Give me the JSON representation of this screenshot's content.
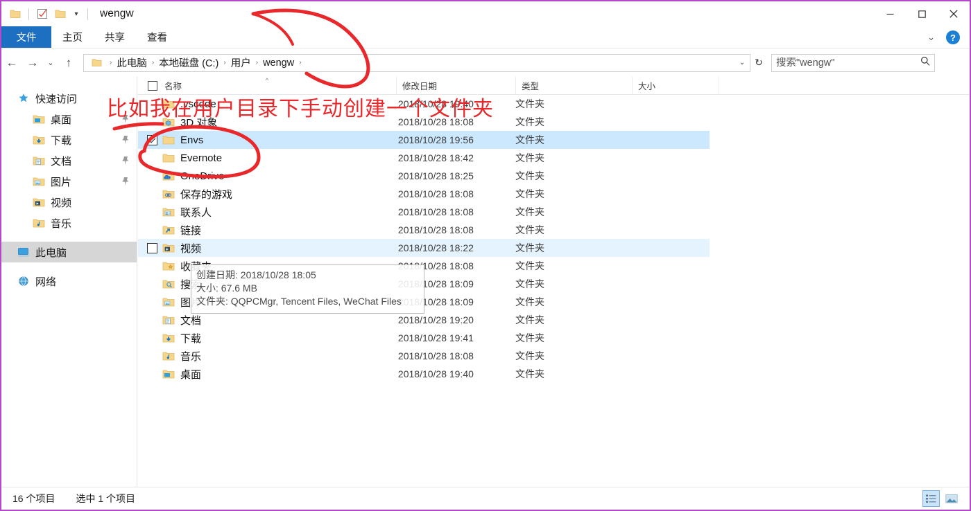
{
  "window": {
    "title": "wengw",
    "qat": [
      {
        "name": "folder-icon",
        "label": ""
      },
      {
        "name": "properties-icon",
        "label": ""
      },
      {
        "name": "new-folder-icon",
        "label": ""
      }
    ],
    "controls": {
      "minimize": "—",
      "maximize": "□",
      "close": "✕"
    }
  },
  "ribbon": {
    "tabs": [
      {
        "label": "文件",
        "active": true
      },
      {
        "label": "主页",
        "active": false
      },
      {
        "label": "共享",
        "active": false
      },
      {
        "label": "查看",
        "active": false
      }
    ],
    "collapse_chevron": "⌄",
    "help_label": "?"
  },
  "addressbar": {
    "back": "←",
    "forward": "→",
    "recent": "⌄",
    "up": "↑",
    "breadcrumbs": [
      "此电脑",
      "本地磁盘 (C:)",
      "用户",
      "wengw"
    ],
    "separator": "›",
    "dropdown": "⌄",
    "refresh": "↻",
    "search": {
      "placeholder": "搜索\"wengw\"",
      "value": "",
      "icon": "search-icon"
    }
  },
  "navpane": {
    "items": [
      {
        "label": "快速访问",
        "icon": "star-icon",
        "level": "root",
        "pinned": false,
        "selected": false
      },
      {
        "label": "桌面",
        "icon": "desktop-folder-icon",
        "level": "child",
        "pinned": true,
        "selected": false
      },
      {
        "label": "下载",
        "icon": "downloads-folder-icon",
        "level": "child",
        "pinned": true,
        "selected": false
      },
      {
        "label": "文档",
        "icon": "documents-folder-icon",
        "level": "child",
        "pinned": true,
        "selected": false
      },
      {
        "label": "图片",
        "icon": "pictures-folder-icon",
        "level": "child",
        "pinned": true,
        "selected": false
      },
      {
        "label": "视频",
        "icon": "videos-folder-icon",
        "level": "child",
        "pinned": false,
        "selected": false
      },
      {
        "label": "音乐",
        "icon": "music-folder-icon",
        "level": "child",
        "pinned": false,
        "selected": false
      },
      {
        "label": "此电脑",
        "icon": "this-pc-icon",
        "level": "root",
        "pinned": false,
        "selected": true
      },
      {
        "label": "网络",
        "icon": "network-icon",
        "level": "root",
        "pinned": false,
        "selected": false
      }
    ]
  },
  "filelist": {
    "columns": [
      {
        "key": "name",
        "label": "名称",
        "sorted": true
      },
      {
        "key": "date",
        "label": "修改日期",
        "sorted": false
      },
      {
        "key": "type",
        "label": "类型",
        "sorted": false
      },
      {
        "key": "size",
        "label": "大小",
        "sorted": false
      }
    ],
    "rows": [
      {
        "name": ".vscode",
        "date": "2018/10/28 19:40",
        "type": "文件夹",
        "size": "",
        "icon": "folder-icon",
        "state": "normal",
        "checkbox": "none"
      },
      {
        "name": "3D 对象",
        "date": "2018/10/28 18:08",
        "type": "文件夹",
        "size": "",
        "icon": "3d-objects-folder-icon",
        "state": "normal",
        "checkbox": "none"
      },
      {
        "name": "Envs",
        "date": "2018/10/28 19:56",
        "type": "文件夹",
        "size": "",
        "icon": "folder-icon",
        "state": "selected",
        "checkbox": "checked"
      },
      {
        "name": "Evernote",
        "date": "2018/10/28 18:42",
        "type": "文件夹",
        "size": "",
        "icon": "folder-icon",
        "state": "normal",
        "checkbox": "none"
      },
      {
        "name": "OneDrive",
        "date": "2018/10/28 18:25",
        "type": "文件夹",
        "size": "",
        "icon": "onedrive-folder-icon",
        "state": "normal",
        "checkbox": "none"
      },
      {
        "name": "保存的游戏",
        "date": "2018/10/28 18:08",
        "type": "文件夹",
        "size": "",
        "icon": "saved-games-folder-icon",
        "state": "normal",
        "checkbox": "none"
      },
      {
        "name": "联系人",
        "date": "2018/10/28 18:08",
        "type": "文件夹",
        "size": "",
        "icon": "contacts-folder-icon",
        "state": "normal",
        "checkbox": "none"
      },
      {
        "name": "链接",
        "date": "2018/10/28 18:08",
        "type": "文件夹",
        "size": "",
        "icon": "links-folder-icon",
        "state": "normal",
        "checkbox": "none"
      },
      {
        "name": "视频",
        "date": "2018/10/28 18:22",
        "type": "文件夹",
        "size": "",
        "icon": "videos-folder-icon",
        "state": "hover",
        "checkbox": "unchecked"
      },
      {
        "name": "收藏夹",
        "date": "2018/10/28 18:08",
        "type": "文件夹",
        "size": "",
        "icon": "favorites-folder-icon",
        "state": "normal",
        "checkbox": "none"
      },
      {
        "name": "搜索",
        "date": "2018/10/28 18:09",
        "type": "文件夹",
        "size": "",
        "icon": "searches-folder-icon",
        "state": "normal",
        "checkbox": "none"
      },
      {
        "name": "图片",
        "date": "2018/10/28 18:09",
        "type": "文件夹",
        "size": "",
        "icon": "pictures-folder-icon",
        "state": "normal",
        "checkbox": "none"
      },
      {
        "name": "文档",
        "date": "2018/10/28 19:20",
        "type": "文件夹",
        "size": "",
        "icon": "documents-folder-icon",
        "state": "normal",
        "checkbox": "none"
      },
      {
        "name": "下载",
        "date": "2018/10/28 19:41",
        "type": "文件夹",
        "size": "",
        "icon": "downloads-folder-icon",
        "state": "normal",
        "checkbox": "none"
      },
      {
        "name": "音乐",
        "date": "2018/10/28 18:08",
        "type": "文件夹",
        "size": "",
        "icon": "music-folder-icon",
        "state": "normal",
        "checkbox": "none"
      },
      {
        "name": "桌面",
        "date": "2018/10/28 19:40",
        "type": "文件夹",
        "size": "",
        "icon": "desktop-folder-icon",
        "state": "normal",
        "checkbox": "none"
      }
    ]
  },
  "tooltip": {
    "lines": [
      "创建日期: 2018/10/28 18:05",
      "大小: 67.6 MB",
      "文件夹: QQPCMgr, Tencent Files, WeChat Files"
    ]
  },
  "statusbar": {
    "item_count": "16 个项目",
    "selected_count": "选中 1 个项目",
    "views": [
      {
        "name": "details-view-button",
        "active": true
      },
      {
        "name": "large-icons-view-button",
        "active": false
      }
    ]
  },
  "annotation": {
    "text": "比如我在用户目录下手动创建一个文件夹",
    "color": "#e8282a"
  }
}
